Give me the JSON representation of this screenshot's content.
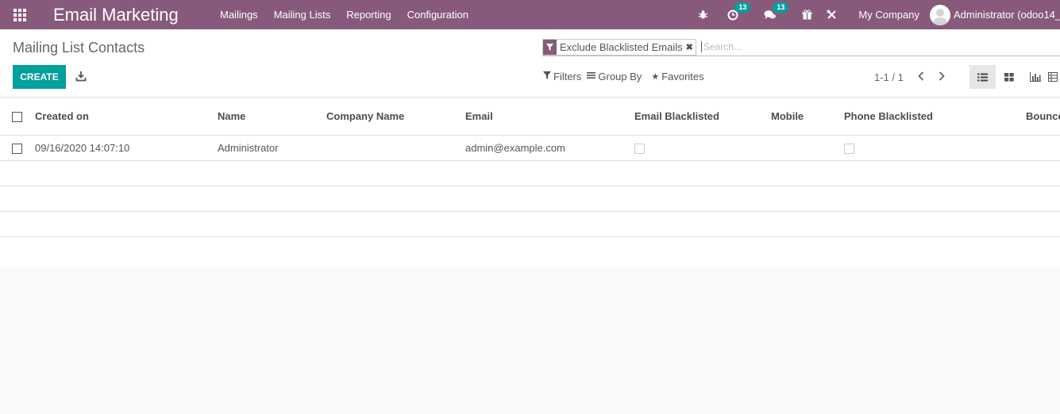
{
  "app": {
    "title": "Email Marketing"
  },
  "menu": [
    "Mailings",
    "Mailing Lists",
    "Reporting",
    "Configuration"
  ],
  "systray": {
    "activity_count": "13",
    "messages_count": "13",
    "company": "My Company",
    "user": "Administrator (odoo14_"
  },
  "breadcrumb": "Mailing List Contacts",
  "search": {
    "facet": "Exclude Blacklisted Emails",
    "placeholder": "Search..."
  },
  "toolbar": {
    "create_label": "CREATE",
    "filters_label": "Filters",
    "groupby_label": "Group By",
    "favorites_label": "Favorites"
  },
  "pager": {
    "value": "1-1 / 1"
  },
  "table": {
    "columns": [
      "Created on",
      "Name",
      "Company Name",
      "Email",
      "Email Blacklisted",
      "Mobile",
      "Phone Blacklisted",
      "Bounce"
    ],
    "rows": [
      {
        "created_on": "09/16/2020 14:07:10",
        "name": "Administrator",
        "company": "",
        "email": "admin@example.com",
        "email_blacklisted": false,
        "mobile": "",
        "phone_blacklisted": false,
        "bounce": ""
      }
    ]
  },
  "colors": {
    "navbar": "#875a7b",
    "primary": "#00a09d"
  }
}
